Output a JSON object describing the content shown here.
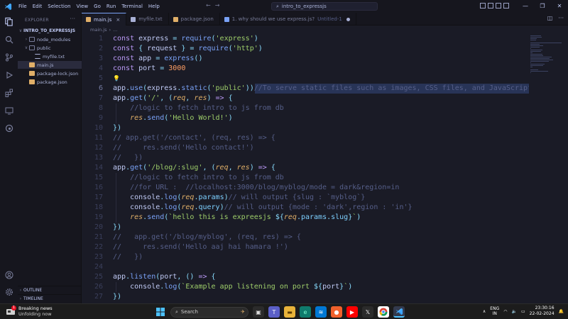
{
  "titlebar": {
    "menu": [
      "File",
      "Edit",
      "Selection",
      "View",
      "Go",
      "Run",
      "Terminal",
      "Help"
    ],
    "search_text": "intro_to_expressjs"
  },
  "explorer": {
    "title": "EXPLORER",
    "project": "INTRO_TO_EXPRESSJS",
    "items": [
      {
        "label": "node_modules",
        "kind": "folder",
        "depth": 1,
        "expanded": false
      },
      {
        "label": "public",
        "kind": "folder",
        "depth": 1,
        "expanded": true
      },
      {
        "label": "myfile.txt",
        "kind": "txt",
        "depth": 2
      },
      {
        "label": "main.js",
        "kind": "js",
        "depth": 1,
        "selected": true
      },
      {
        "label": "package-lock.json",
        "kind": "json",
        "depth": 1
      },
      {
        "label": "package.json",
        "kind": "json",
        "depth": 1
      }
    ],
    "outline_label": "OUTLINE",
    "timeline_label": "TIMELINE"
  },
  "tabs": [
    {
      "label": "main.js",
      "icon": "js",
      "active": true,
      "close": "×"
    },
    {
      "label": "myfile.txt",
      "icon": "txt"
    },
    {
      "label": "package.json",
      "icon": "json"
    },
    {
      "label": "1. why should we use express.js?",
      "suffix": "Untitled-1",
      "icon": "md",
      "dirty": true
    }
  ],
  "breadcrumb": [
    "main.js",
    "..."
  ],
  "editor": {
    "lines": [
      {
        "n": "1",
        "t": [
          [
            "k",
            "const "
          ],
          [
            "v",
            "express "
          ],
          [
            "p",
            "= "
          ],
          [
            "f",
            "require"
          ],
          [
            "p",
            "("
          ],
          [
            "s",
            "'express'"
          ],
          [
            "p",
            ")"
          ]
        ]
      },
      {
        "n": "2",
        "t": [
          [
            "k",
            "const "
          ],
          [
            "p",
            "{ "
          ],
          [
            "v",
            "request "
          ],
          [
            "p",
            "} = "
          ],
          [
            "f",
            "require"
          ],
          [
            "p",
            "("
          ],
          [
            "s",
            "'http'"
          ],
          [
            "p",
            ")"
          ]
        ]
      },
      {
        "n": "3",
        "t": [
          [
            "k",
            "const "
          ],
          [
            "v",
            "app "
          ],
          [
            "p",
            "= "
          ],
          [
            "f",
            "express"
          ],
          [
            "p",
            "()"
          ]
        ]
      },
      {
        "n": "4",
        "t": [
          [
            "k",
            "const "
          ],
          [
            "v",
            "port "
          ],
          [
            "p",
            "= "
          ],
          [
            "n",
            "3000"
          ]
        ]
      },
      {
        "n": "5",
        "t": [],
        "bulb": true
      },
      {
        "n": "6",
        "t": [
          [
            "v",
            "app"
          ],
          [
            "p",
            "."
          ],
          [
            "f",
            "use"
          ],
          [
            "p",
            "("
          ],
          [
            "v",
            "express"
          ],
          [
            "p",
            "."
          ],
          [
            "f",
            "static"
          ],
          [
            "p",
            "("
          ],
          [
            "s",
            "'public'"
          ],
          [
            "p",
            "))"
          ],
          [
            "c",
            "//"
          ],
          [
            "c",
            "To serve static files such as images, CSS files, and JavaScript files"
          ]
        ],
        "cur": true
      },
      {
        "n": "7",
        "t": [
          [
            "v",
            "app"
          ],
          [
            "p",
            "."
          ],
          [
            "f",
            "get"
          ],
          [
            "p",
            "("
          ],
          [
            "s",
            "'/'"
          ],
          [
            "p",
            ", ("
          ],
          [
            "prm",
            "req"
          ],
          [
            "p",
            ", "
          ],
          [
            "prm",
            "res"
          ],
          [
            "p",
            ") "
          ],
          [
            "k",
            "=> "
          ],
          [
            "p",
            "{"
          ]
        ]
      },
      {
        "n": "8",
        "t": [
          [
            "v",
            "    "
          ],
          [
            "c",
            "//logic to fetch intro to js from db"
          ]
        ]
      },
      {
        "n": "9",
        "t": [
          [
            "v",
            "    "
          ],
          [
            "prm",
            "res"
          ],
          [
            "p",
            "."
          ],
          [
            "f",
            "send"
          ],
          [
            "p",
            "("
          ],
          [
            "s",
            "'Hello World!'"
          ],
          [
            "p",
            ")"
          ]
        ]
      },
      {
        "n": "10",
        "t": [
          [
            "p",
            "})"
          ]
        ]
      },
      {
        "n": "11",
        "t": [
          [
            "c",
            "// app.get('/contact', (req, res) => {"
          ]
        ]
      },
      {
        "n": "12",
        "t": [
          [
            "c",
            "//     res.send('Hello contact!')"
          ]
        ]
      },
      {
        "n": "13",
        "t": [
          [
            "c",
            "//   })"
          ]
        ]
      },
      {
        "n": "14",
        "t": [
          [
            "v",
            "app"
          ],
          [
            "p",
            "."
          ],
          [
            "f",
            "get"
          ],
          [
            "p",
            "("
          ],
          [
            "s",
            "'/blog/:slug'"
          ],
          [
            "p",
            ", ("
          ],
          [
            "prm",
            "req"
          ],
          [
            "p",
            ", "
          ],
          [
            "prm",
            "res"
          ],
          [
            "p",
            ") "
          ],
          [
            "k",
            "=> "
          ],
          [
            "p",
            "{"
          ]
        ]
      },
      {
        "n": "15",
        "t": [
          [
            "v",
            "    "
          ],
          [
            "c",
            "//logic to fetch intro to js from db"
          ]
        ]
      },
      {
        "n": "16",
        "t": [
          [
            "v",
            "    "
          ],
          [
            "c",
            "//for URL :  //localhost:3000/blog/myblog/mode = dark&region=in"
          ]
        ]
      },
      {
        "n": "17",
        "t": [
          [
            "v",
            "    "
          ],
          [
            "v",
            "console"
          ],
          [
            "p",
            "."
          ],
          [
            "f",
            "log"
          ],
          [
            "p",
            "("
          ],
          [
            "prm",
            "req"
          ],
          [
            "p",
            "."
          ],
          [
            "iv",
            "params"
          ],
          [
            "p",
            ")"
          ],
          [
            "c",
            "// will output {slug : `myblog`}"
          ]
        ]
      },
      {
        "n": "18",
        "t": [
          [
            "v",
            "    "
          ],
          [
            "v",
            "console"
          ],
          [
            "p",
            "."
          ],
          [
            "f",
            "log"
          ],
          [
            "p",
            "("
          ],
          [
            "prm",
            "req"
          ],
          [
            "p",
            "."
          ],
          [
            "iv",
            "query"
          ],
          [
            "p",
            ")"
          ],
          [
            "c",
            "// will output {mode : 'dark',region : 'in'}"
          ]
        ]
      },
      {
        "n": "19",
        "t": [
          [
            "v",
            "    "
          ],
          [
            "prm",
            "res"
          ],
          [
            "p",
            "."
          ],
          [
            "f",
            "send"
          ],
          [
            "p",
            "("
          ],
          [
            "tl",
            "`hello this is expreesjs "
          ],
          [
            "p",
            "${"
          ],
          [
            "prm",
            "req"
          ],
          [
            "p",
            "."
          ],
          [
            "iv",
            "params"
          ],
          [
            "p",
            "."
          ],
          [
            "iv",
            "slug"
          ],
          [
            "p",
            "}"
          ],
          [
            "tl",
            "`"
          ],
          [
            "p",
            ")"
          ]
        ]
      },
      {
        "n": "20",
        "t": [
          [
            "p",
            "})"
          ]
        ]
      },
      {
        "n": "21",
        "t": [
          [
            "c",
            "//   app.get('/blog/myblog', (req, res) => {"
          ]
        ]
      },
      {
        "n": "22",
        "t": [
          [
            "c",
            "//     res.send('Hello aaj hai hamara !')"
          ]
        ]
      },
      {
        "n": "23",
        "t": [
          [
            "c",
            "//   })"
          ]
        ]
      },
      {
        "n": "24",
        "t": []
      },
      {
        "n": "25",
        "t": [
          [
            "v",
            "app"
          ],
          [
            "p",
            "."
          ],
          [
            "f",
            "listen"
          ],
          [
            "p",
            "("
          ],
          [
            "v",
            "port"
          ],
          [
            "p",
            ", () "
          ],
          [
            "k",
            "=> "
          ],
          [
            "p",
            "{"
          ]
        ]
      },
      {
        "n": "26",
        "t": [
          [
            "v",
            "    "
          ],
          [
            "v",
            "console"
          ],
          [
            "p",
            "."
          ],
          [
            "f",
            "log"
          ],
          [
            "p",
            "("
          ],
          [
            "tl",
            "`Example app listening on port "
          ],
          [
            "p",
            "${"
          ],
          [
            "v",
            "port"
          ],
          [
            "p",
            "}"
          ],
          [
            "tl",
            "`"
          ],
          [
            "p",
            ")"
          ]
        ]
      },
      {
        "n": "27",
        "t": [
          [
            "p",
            "})"
          ]
        ]
      }
    ]
  },
  "taskbar": {
    "news_title": "Breaking news",
    "news_sub": "Unfolding now",
    "news_badge": "1",
    "search_label": "Search",
    "lang_top": "ENG",
    "lang_bottom": "IN",
    "time": "23:30:16",
    "date": "22-02-2024"
  },
  "colors": {
    "accent": "#7aa2f7",
    "editor_bg": "#1a1b26",
    "sidebar_bg": "#16161e"
  }
}
